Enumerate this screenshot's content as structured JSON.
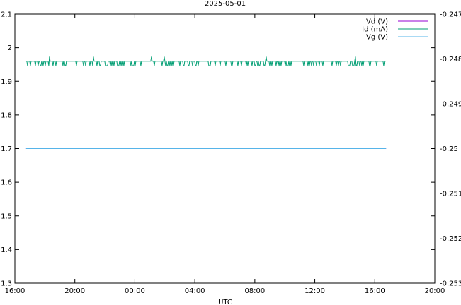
{
  "chart_data": {
    "type": "line",
    "title": "2025-05-01",
    "xlabel": "UTC",
    "ylabel": "",
    "y2label": "",
    "x_tick_labels": [
      "16:00",
      "20:00",
      "00:00",
      "04:00",
      "08:00",
      "12:00",
      "16:00",
      "20:00"
    ],
    "xlim_hours": [
      16,
      44
    ],
    "ylim": [
      1.3,
      2.1
    ],
    "y_ticks": [
      1.3,
      1.4,
      1.5,
      1.6,
      1.7,
      1.8,
      1.9,
      2,
      2.1
    ],
    "y2lim": [
      -0.253,
      -0.247
    ],
    "y2_ticks": [
      -0.253,
      -0.252,
      -0.251,
      -0.25,
      -0.249,
      -0.248,
      -0.247
    ],
    "grid": false,
    "legend_position": "top-right",
    "series": [
      {
        "name": "Vd (V)",
        "color": "#9400d3",
        "axis": "y1",
        "x_start_hours": 16.75,
        "x_end_hours": 40.75,
        "values": [
          1.7,
          1.7
        ]
      },
      {
        "name": "Id (mA)",
        "color": "#009e73",
        "axis": "y2",
        "x_start_hours": 16.75,
        "x_end_hours": 40.75,
        "baseline": -0.24805,
        "noise_low": -0.24815,
        "spike_high": -0.24795
      },
      {
        "name": "Vg (V)",
        "color": "#56b4e9",
        "axis": "y1",
        "x_start_hours": 16.75,
        "x_end_hours": 40.75,
        "values": [
          1.7,
          1.7
        ]
      }
    ]
  }
}
